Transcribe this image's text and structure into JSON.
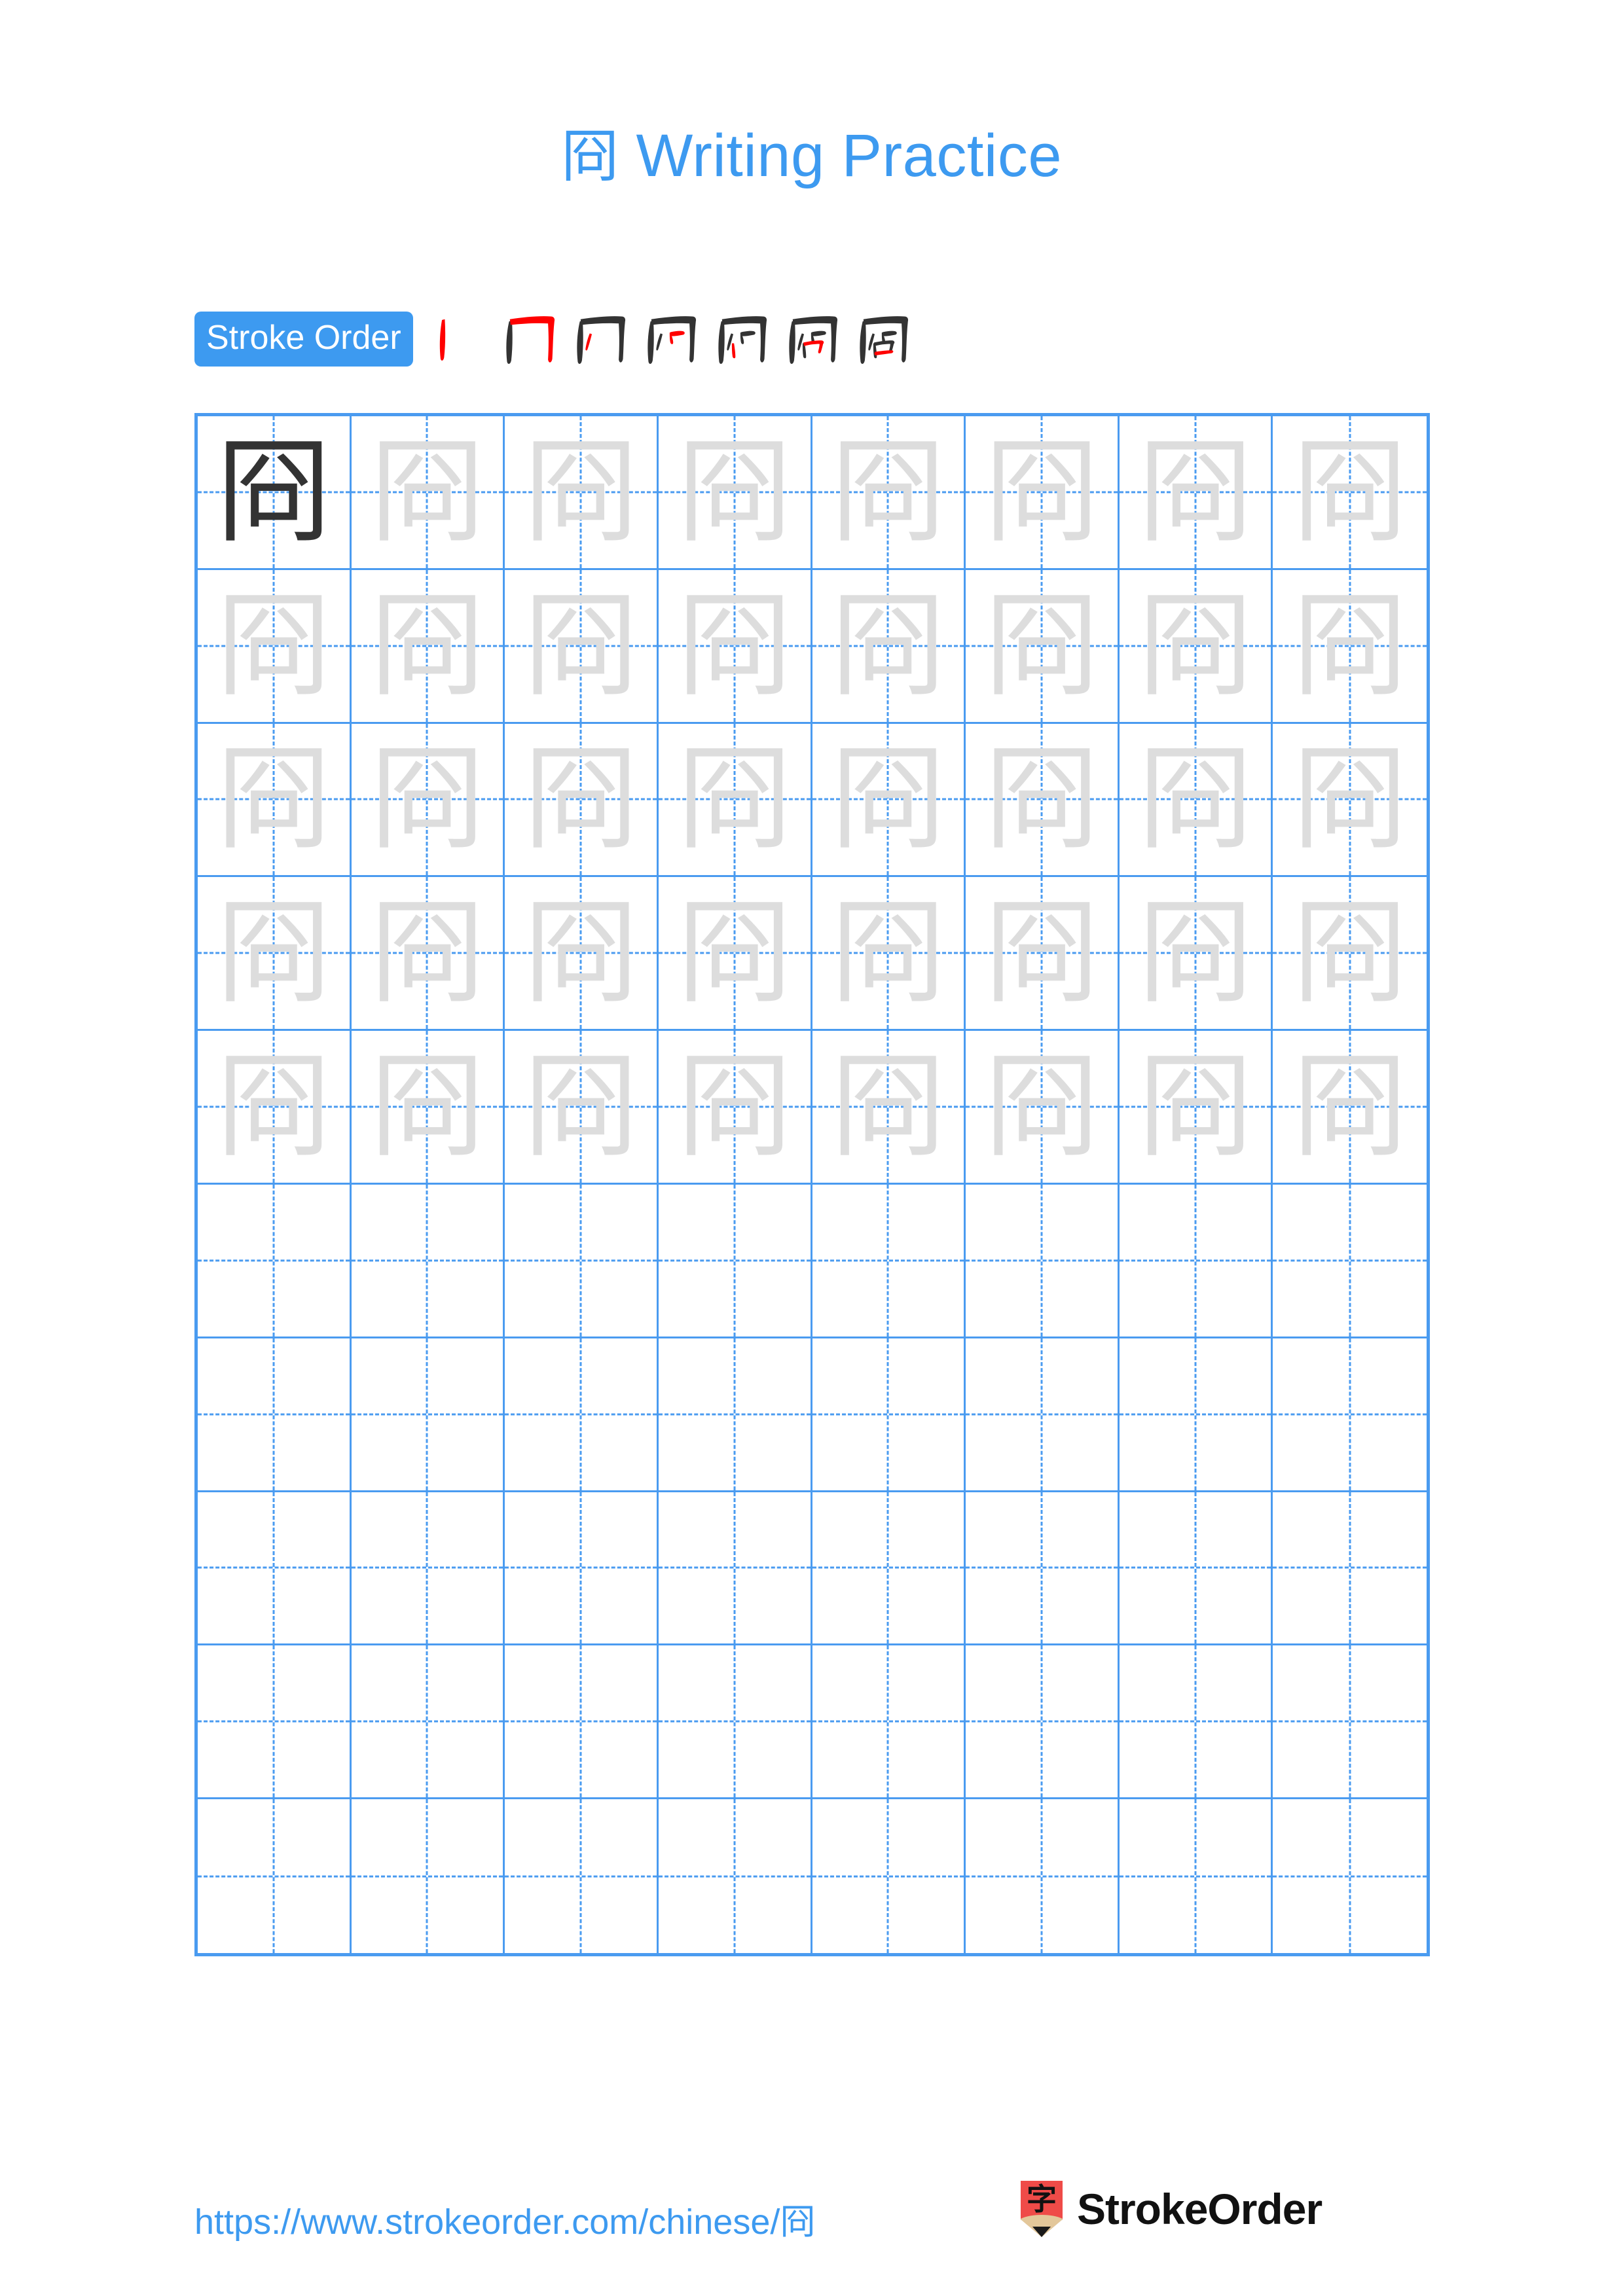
{
  "document": {
    "character": "冏",
    "title_suffix": " Writing Practice",
    "title_full": "冏 Writing Practice",
    "background_color": "#ffffff",
    "accent_color": "#3d9af0",
    "grid_line_color": "#4a9bf0",
    "trace_char_color": "#dddddd",
    "dark_char_color": "#333333",
    "highlight_stroke_color": "#ff0000"
  },
  "stroke_order": {
    "badge_label": "Stroke Order",
    "badge_background": "#3d9af0",
    "badge_text_color": "#ffffff",
    "total_strokes": 7,
    "steps": [
      {
        "index": 1,
        "char": "冂",
        "partial": "丨",
        "new_stroke": "丨 vertical left"
      },
      {
        "index": 2,
        "char": "冂",
        "partial": "冂",
        "new_stroke": "横折钩 top + right hook"
      },
      {
        "index": 3,
        "char": "冏",
        "partial": "冂丿",
        "new_stroke": "丿 left short slant inside"
      },
      {
        "index": 4,
        "char": "冏",
        "partial": "冂丿乛",
        "new_stroke": "乛 right short hook inside"
      },
      {
        "index": 5,
        "char": "冏",
        "partial": "冂丿乛丨",
        "new_stroke": "丨 inner left vertical"
      },
      {
        "index": 6,
        "char": "冏",
        "partial": "冂丿乛丨乛",
        "new_stroke": "乛 inner box turn"
      },
      {
        "index": 7,
        "char": "冏",
        "partial": "冏",
        "new_stroke": "一 inner bottom horizontal"
      }
    ]
  },
  "practice_grid": {
    "columns": 8,
    "rows": 10,
    "cell_type": "tian-zi-ge",
    "filled_rows": 5,
    "blank_rows": 5,
    "rows_data": [
      [
        "dark",
        "trace",
        "trace",
        "trace",
        "trace",
        "trace",
        "trace",
        "trace"
      ],
      [
        "trace",
        "trace",
        "trace",
        "trace",
        "trace",
        "trace",
        "trace",
        "trace"
      ],
      [
        "trace",
        "trace",
        "trace",
        "trace",
        "trace",
        "trace",
        "trace",
        "trace"
      ],
      [
        "trace",
        "trace",
        "trace",
        "trace",
        "trace",
        "trace",
        "trace",
        "trace"
      ],
      [
        "trace",
        "trace",
        "trace",
        "trace",
        "trace",
        "trace",
        "trace",
        "trace"
      ],
      [
        "empty",
        "empty",
        "empty",
        "empty",
        "empty",
        "empty",
        "empty",
        "empty"
      ],
      [
        "empty",
        "empty",
        "empty",
        "empty",
        "empty",
        "empty",
        "empty",
        "empty"
      ],
      [
        "empty",
        "empty",
        "empty",
        "empty",
        "empty",
        "empty",
        "empty",
        "empty"
      ],
      [
        "empty",
        "empty",
        "empty",
        "empty",
        "empty",
        "empty",
        "empty",
        "empty"
      ],
      [
        "empty",
        "empty",
        "empty",
        "empty",
        "empty",
        "empty",
        "empty",
        "empty"
      ]
    ]
  },
  "footer": {
    "url": "https://www.strokeorder.com/chinese/冏",
    "brand_name": "StrokeOrder",
    "logo_character": "字",
    "logo_background": "#ef4b48",
    "logo_wood_color": "#e3c79a",
    "logo_tip_color": "#1a1a1a"
  }
}
